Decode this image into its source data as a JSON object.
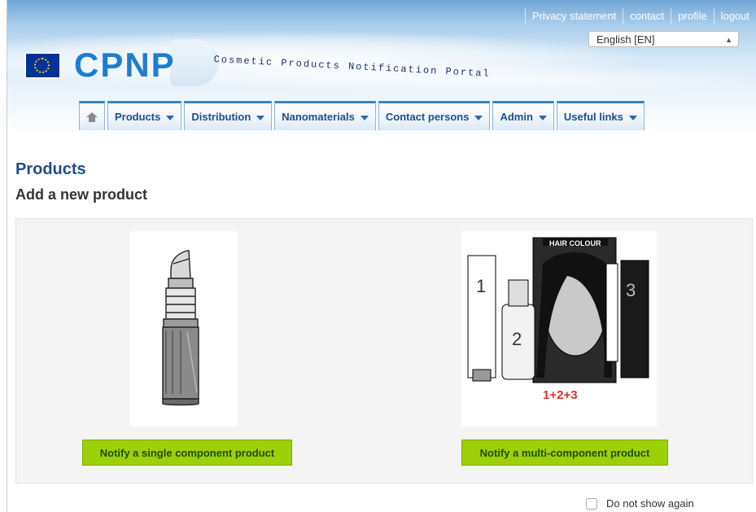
{
  "header": {
    "top_links": [
      "Privacy statement",
      "contact",
      "profile",
      "logout"
    ],
    "language": "English [EN]",
    "logo_text": "CPNP",
    "tagline": "Cosmetic Products Notification Portal"
  },
  "nav": {
    "items": [
      {
        "label": "Products",
        "has_dropdown": true
      },
      {
        "label": "Distribution",
        "has_dropdown": true
      },
      {
        "label": "Nanomaterials",
        "has_dropdown": true
      },
      {
        "label": "Contact persons",
        "has_dropdown": true
      },
      {
        "label": "Admin",
        "has_dropdown": true
      },
      {
        "label": "Useful links",
        "has_dropdown": true
      }
    ],
    "home_icon": "home-icon"
  },
  "main": {
    "title": "Products",
    "subtitle": "Add a new product",
    "cards": [
      {
        "image": "lipstick-sketch",
        "button_label": "Notify a single component product"
      },
      {
        "image": "hair-colour-kit-sketch",
        "image_text": "HAIR COLOUR",
        "image_numbers": [
          "1",
          "2",
          "3"
        ],
        "image_caption": "1+2+3",
        "button_label": "Notify a multi-component product"
      }
    ],
    "dont_show_again": "Do not show again"
  },
  "colors": {
    "accent": "#1f4e8a",
    "button": "#9ed00a",
    "button_text": "#1d4d10",
    "logo": "#1c7ed0",
    "caption_red": "#e0302a"
  }
}
